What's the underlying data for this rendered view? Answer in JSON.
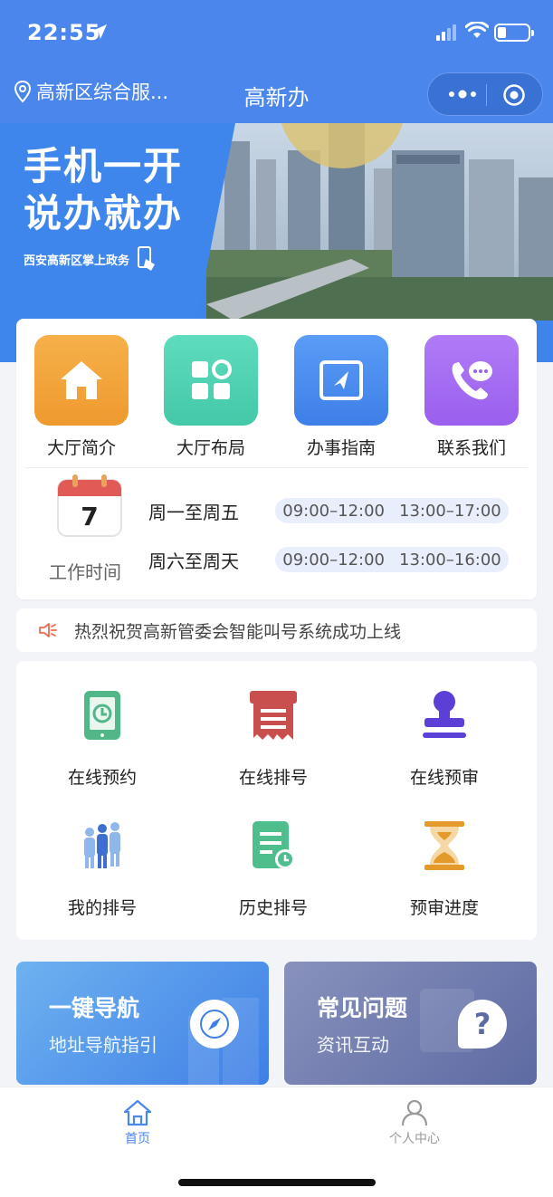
{
  "status_bar": {
    "time": "22:55"
  },
  "nav": {
    "location": "高新区综合服...",
    "title": "高新办"
  },
  "banner": {
    "title_line1": "手机一开",
    "title_line2": "说办就办",
    "subtitle": "西安高新区掌上政务"
  },
  "quick_links": [
    {
      "label": "大厅简介",
      "icon": "home-icon",
      "color": "#f1a43a"
    },
    {
      "label": "大厅布局",
      "icon": "layout-grid-icon",
      "color": "#4fd0b0"
    },
    {
      "label": "办事指南",
      "icon": "guide-book-icon",
      "color": "#4a8df0"
    },
    {
      "label": "联系我们",
      "icon": "phone-chat-icon",
      "color": "#a56cf0"
    }
  ],
  "work_hours": {
    "calendar_day": "7",
    "label": "工作时间",
    "rows": [
      {
        "days": "周一至周五",
        "morning": "09:00–12:00",
        "afternoon": "13:00–17:00"
      },
      {
        "days": "周六至周天",
        "morning": "09:00–12:00",
        "afternoon": "13:00–16:00"
      }
    ]
  },
  "notice": {
    "text": "热烈祝贺高新管委会智能叫号系统成功上线"
  },
  "services": [
    {
      "label": "在线预约",
      "icon": "phone-clock-icon"
    },
    {
      "label": "在线排号",
      "icon": "ticket-icon"
    },
    {
      "label": "在线预审",
      "icon": "stamp-icon"
    },
    {
      "label": "我的排号",
      "icon": "people-queue-icon"
    },
    {
      "label": "历史排号",
      "icon": "history-doc-icon"
    },
    {
      "label": "预审进度",
      "icon": "hourglass-icon"
    }
  ],
  "promos": [
    {
      "title": "一键导航",
      "subtitle": "地址导航指引",
      "icon": "compass-icon"
    },
    {
      "title": "常见问题",
      "subtitle": "资讯互动",
      "icon": "question-icon"
    }
  ],
  "tabbar": [
    {
      "label": "首页",
      "icon": "home-tab-icon",
      "active": true
    },
    {
      "label": "个人中心",
      "icon": "user-icon",
      "active": false
    }
  ],
  "colors": {
    "brand": "#4a86ec",
    "active_tab": "#4a86ec",
    "inactive_tab": "#999999"
  }
}
